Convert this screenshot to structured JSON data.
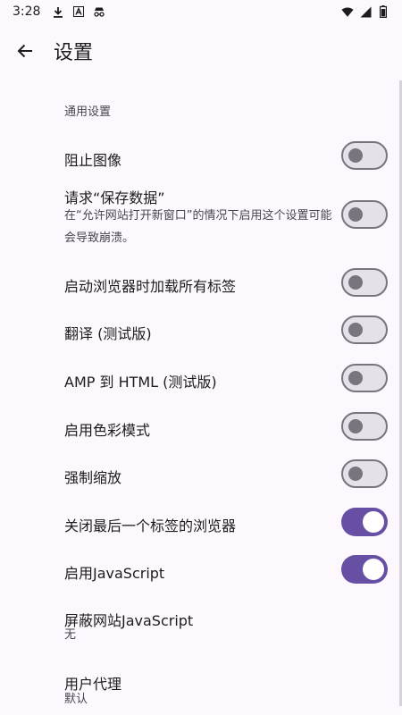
{
  "status_bar": {
    "time": "3:28",
    "left_icons": [
      "download-icon",
      "app-a-icon",
      "incognito-icon"
    ],
    "right_icons": [
      "wifi-icon",
      "signal-icon",
      "battery-icon"
    ]
  },
  "app_bar": {
    "back_icon": "arrow-back-icon",
    "title": "设置"
  },
  "settings": {
    "category": "通用设置",
    "rows": [
      {
        "title": "阻止图像",
        "switch": "off"
      },
      {
        "title": "请求“保存数据”",
        "summary": "在“允许网站打开新窗口”的情况下启用这个设置可能会导致崩溃。",
        "switch": "off"
      },
      {
        "title": "启动浏览器时加载所有标签",
        "switch": "off"
      },
      {
        "title": "翻译 (测试版)",
        "switch": "off"
      },
      {
        "title": "AMP 到 HTML (测试版)",
        "switch": "off"
      },
      {
        "title": "启用色彩模式",
        "switch": "off"
      },
      {
        "title": "强制缩放",
        "switch": "off"
      },
      {
        "title": "关闭最后一个标签的浏览器",
        "switch": "on"
      },
      {
        "title": "启用JavaScript",
        "switch": "on"
      },
      {
        "title": "屏蔽网站JavaScript",
        "summary": "无"
      },
      {
        "title": "用户代理",
        "summary": "默认"
      }
    ]
  },
  "colors": {
    "accent": "#6750a4",
    "switch_off_track": "#e6e0e9",
    "switch_off_outline": "#79747e",
    "background": "#fdf8fd"
  }
}
